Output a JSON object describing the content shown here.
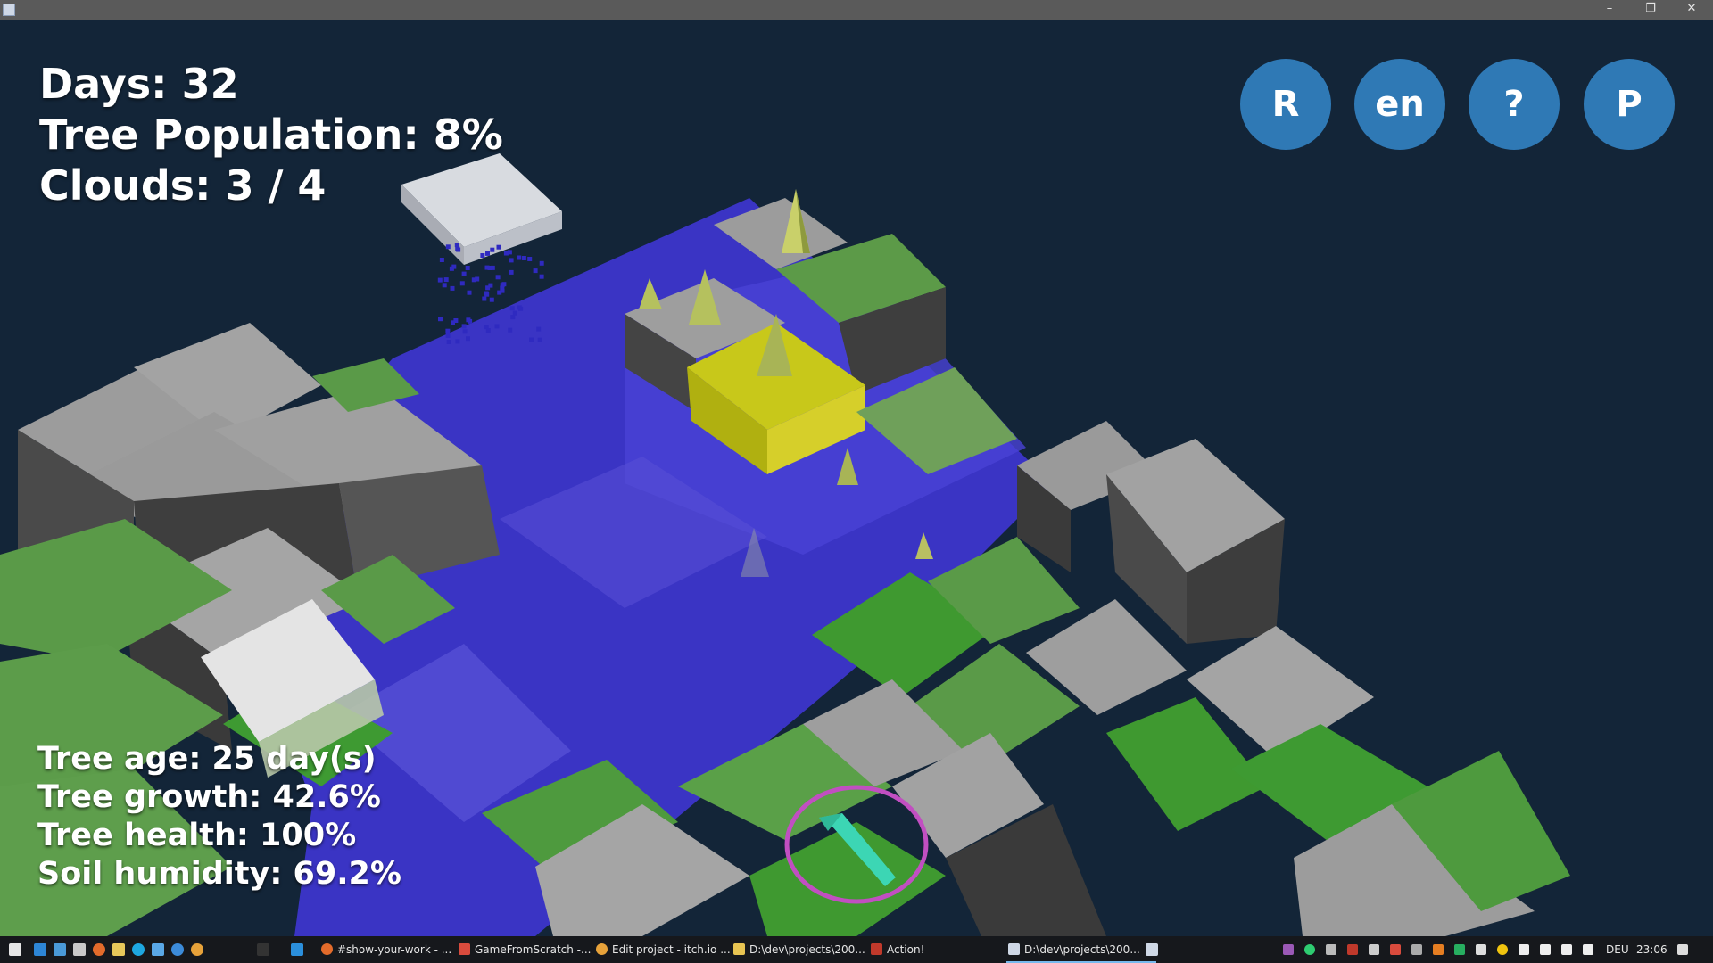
{
  "window": {
    "app_icon": "window-app-icon",
    "minimize": "–",
    "maximize": "❐",
    "close": "✕"
  },
  "hud": {
    "days": "Days: 32",
    "tree_population": "Tree Population: 8%",
    "clouds": "Clouds: 3 / 4",
    "tree_age": "Tree age: 25 day(s)",
    "tree_growth": "Tree growth: 42.6%",
    "tree_health": "Tree health: 100%",
    "soil_humidity": "Soil humidity: 69.2%"
  },
  "buttons": {
    "restart": "R",
    "language": "en",
    "help": "?",
    "pause": "P"
  },
  "colors": {
    "background": "#132538",
    "button": "#2f79b5",
    "stone": "#9a9a9a",
    "grass": "#4f9a3d",
    "water": "#3b35c8",
    "selected_tile": "#d2d21e",
    "cursor_ring": "#c14fc1",
    "cursor_arrow": "#3cd6b4"
  },
  "taskbar": {
    "tasks": [
      {
        "label": "#show-your-work - ...",
        "icon": "firefox-icon"
      },
      {
        "label": "GameFromScratch -...",
        "icon": "gmail-icon"
      },
      {
        "label": "Edit project - itch.io ...",
        "icon": "chrome-icon"
      },
      {
        "label": "D:\\dev\\projects\\200...",
        "icon": "folder-icon"
      },
      {
        "label": "Action!",
        "icon": "action-recorder-icon"
      },
      {
        "label": "D:\\dev\\projects\\200...",
        "icon": "game-window-icon"
      }
    ],
    "language": "DEU",
    "time": "23:06"
  }
}
